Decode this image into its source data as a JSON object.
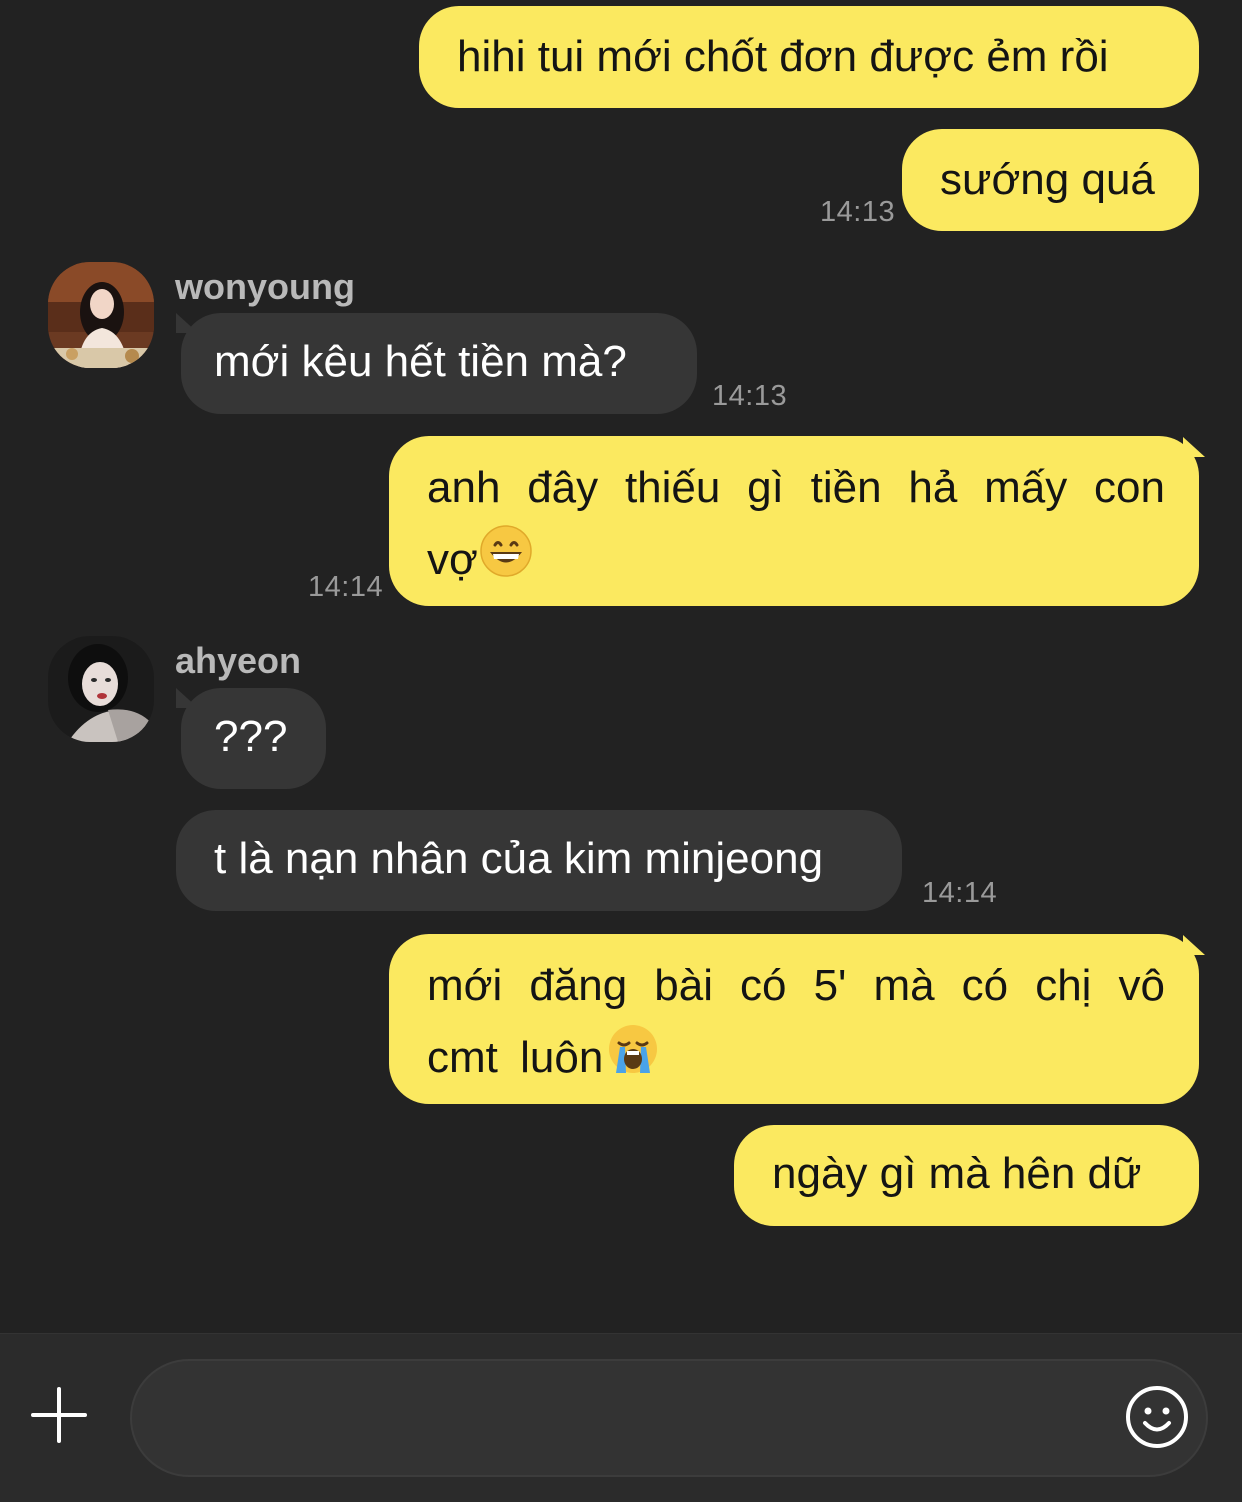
{
  "messages": [
    {
      "text": "hihi tui mới chốt đơn được ẻm rồi"
    },
    {
      "text": "sướng quá",
      "time": "14:13"
    },
    {
      "sender": "wonyoung",
      "text": "mới kêu hết tiền mà?",
      "time": "14:13"
    },
    {
      "text": "anh đây thiếu gì tiền hả mấy con vợ",
      "emoji": "grinning-face-emoji",
      "time": "14:14"
    },
    {
      "sender": "ahyeon",
      "text": "???"
    },
    {
      "text": "t là nạn nhân của kim minjeong",
      "time": "14:14"
    },
    {
      "text": "mới đăng bài có 5' mà có chị vô cmt luôn",
      "emoji": "loudly-crying-face-emoji"
    },
    {
      "text": "ngày gì mà hên dữ"
    }
  ],
  "composer": {
    "value": "",
    "placeholder": "",
    "plus_icon": "plus-icon",
    "emoji_icon": "smiley-icon"
  },
  "colors": {
    "background": "#222222",
    "outgoing_bubble": "#fbe960",
    "incoming_bubble": "#363636",
    "timestamp": "#9a9a9a",
    "sender_name": "#b9b9b9"
  }
}
